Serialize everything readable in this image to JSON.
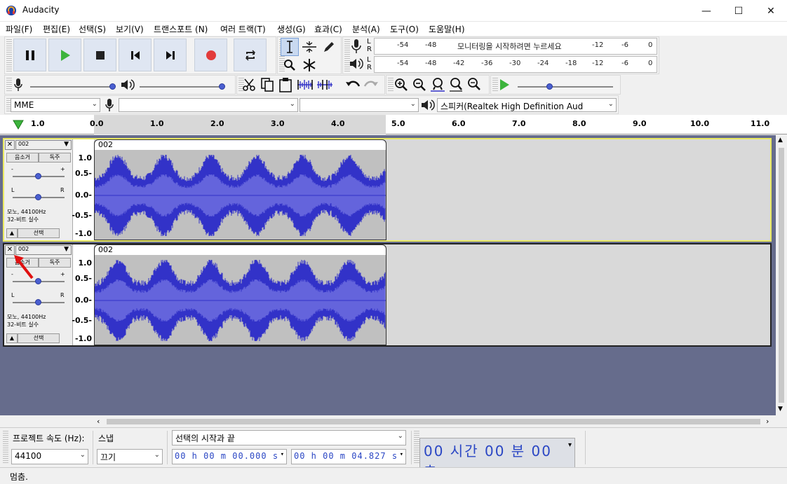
{
  "window": {
    "title": "Audacity"
  },
  "menu": [
    "파일(F)",
    "편집(E)",
    "선택(S)",
    "보기(V)",
    "트랜스포트 (N)",
    "여러 트랙(T)",
    "생성(G)",
    "효과(C)",
    "분석(A)",
    "도구(O)",
    "도움말(H)"
  ],
  "meter": {
    "rec_ticks": [
      "-54",
      "-48",
      "-12",
      "-6",
      "0"
    ],
    "rec_message": "모니터링을 시작하려면 누르세요",
    "play_ticks": [
      "-54",
      "-48",
      "-42",
      "-36",
      "-30",
      "-24",
      "-18",
      "-12",
      "-6",
      "0"
    ],
    "lr": [
      "L",
      "R"
    ]
  },
  "devices": {
    "host": "MME",
    "input": "",
    "channels": "",
    "output": "스피커(Realtek High Definition Aud"
  },
  "ruler": {
    "ticks": [
      "1.0",
      "0.0",
      "1.0",
      "2.0",
      "3.0",
      "4.0",
      "5.0",
      "6.0",
      "7.0",
      "8.0",
      "9.0",
      "10.0",
      "11.0"
    ]
  },
  "tracks": [
    {
      "name": "002",
      "clip_name": "002",
      "mute": "음소거",
      "solo": "독주",
      "gain_min": "-",
      "gain_max": "+",
      "pan_left": "L",
      "pan_right": "R",
      "format_rate": "모노, 44100Hz",
      "format_bits": "32-비트 실수",
      "select": "선택",
      "y_ticks": [
        "1.0",
        "0.5-",
        "0.0-",
        "-0.5-",
        "-1.0"
      ]
    },
    {
      "name": "002",
      "clip_name": "002",
      "mute": "음소거",
      "solo": "독주",
      "gain_min": "-",
      "gain_max": "+",
      "pan_left": "L",
      "pan_right": "R",
      "format_rate": "모노, 44100Hz",
      "format_bits": "32-비트 실수",
      "select": "선택",
      "y_ticks": [
        "1.0",
        "0.5-",
        "0.0-",
        "-0.5-",
        "-1.0"
      ]
    }
  ],
  "bottom": {
    "rate_label": "프로젝트 속도 (Hz):",
    "rate_value": "44100",
    "snap_label": "스냅",
    "snap_value": "끄기",
    "selection_mode": "선택의 시작과 끝",
    "start_time": "00 h 00 m 00.000 s",
    "end_time": "00 h 00 m 04.827 s",
    "audio_position": "00 시간 00 분 00 초"
  },
  "status": {
    "text": "멈춤."
  },
  "colors": {
    "waveform": "#3232c8",
    "waveform_rms": "#6464dc",
    "selected_border": "#f0f04a",
    "record": "#e23b3b",
    "play": "#3cb43c"
  }
}
